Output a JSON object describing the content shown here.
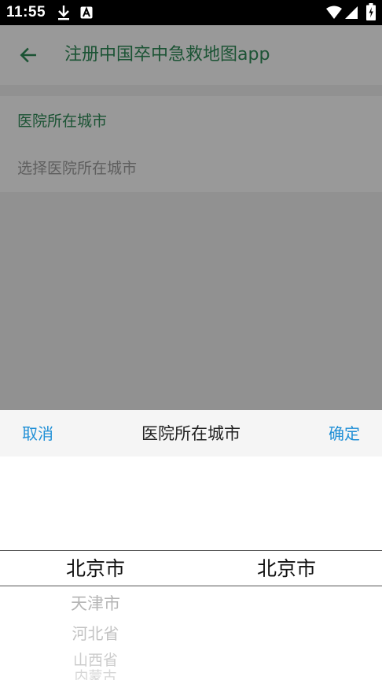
{
  "status_bar": {
    "time": "11:55",
    "icons": [
      "download-icon",
      "a-badge-icon",
      "wifi-icon",
      "signal-icon",
      "battery-icon"
    ]
  },
  "app_bar": {
    "back_icon": "arrow-left-icon",
    "title": "注册中国卒中急救地图app",
    "title_color": "#2e8b57"
  },
  "form": {
    "field_label": "医院所在城市",
    "field_placeholder": "选择医院所在城市"
  },
  "picker": {
    "cancel_label": "取消",
    "title": "医院所在城市",
    "confirm_label": "确定",
    "accent_color": "#1f8fd6",
    "province_column": {
      "selected": "北京市",
      "below": [
        "天津市",
        "河北省",
        "山西省",
        "内蒙古"
      ]
    },
    "city_column": {
      "selected": "北京市"
    }
  }
}
